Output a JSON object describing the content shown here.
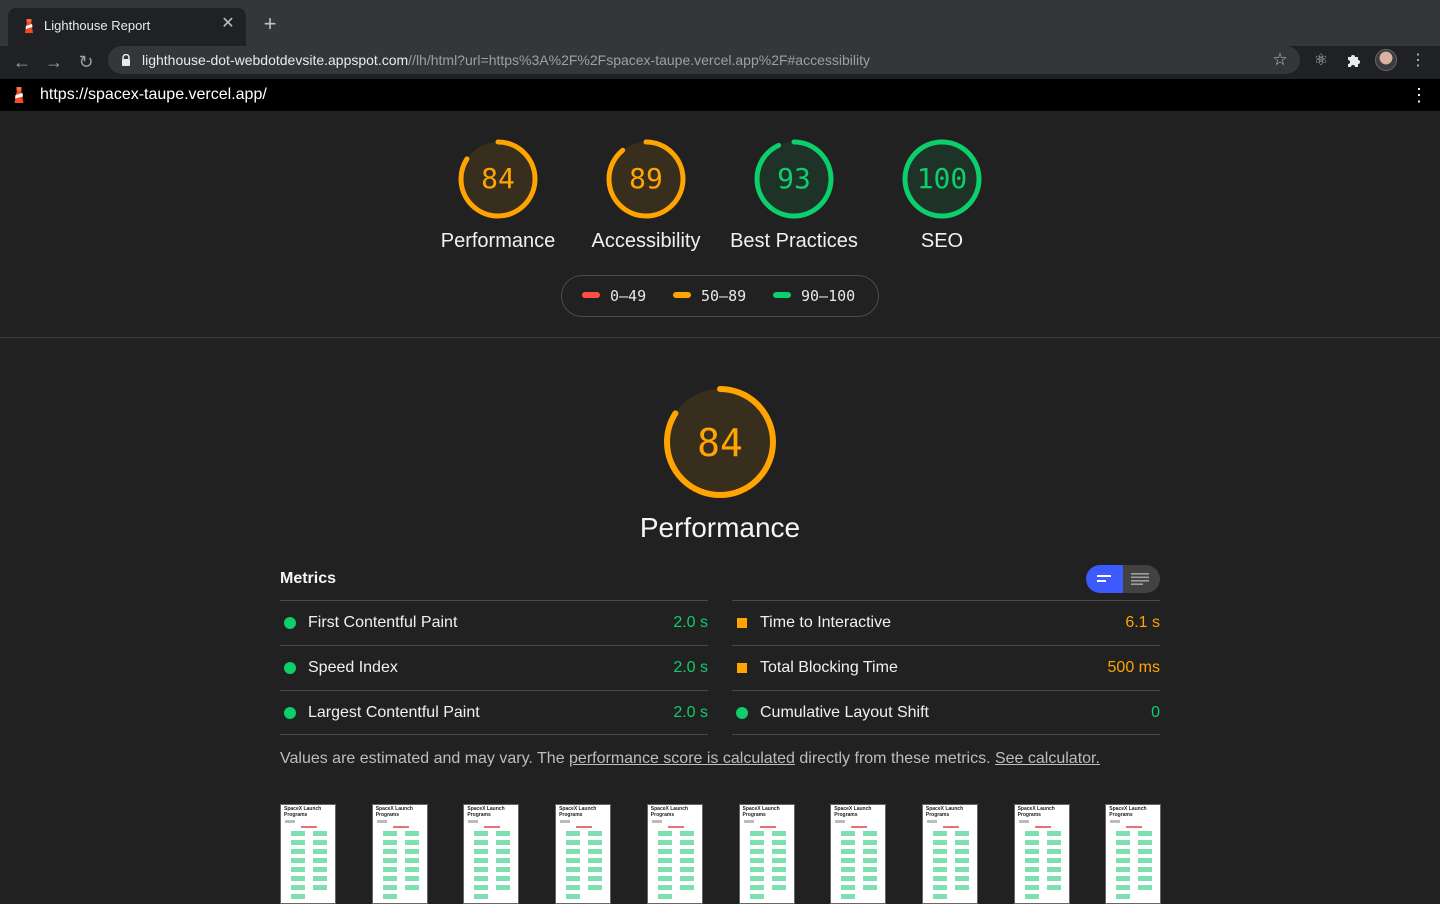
{
  "browser": {
    "tab_title": "Lighthouse Report",
    "url_host": "lighthouse-dot-webdotdevsite.appspot.com",
    "url_path": "//lh/html?url=https%3A%2F%2Fspacex-taupe.vercel.app%2F#accessibility"
  },
  "report": {
    "page_url": "https://spacex-taupe.vercel.app/"
  },
  "scores": [
    {
      "label": "Performance",
      "value": "84",
      "score": 84,
      "color": "#ffa400"
    },
    {
      "label": "Accessibility",
      "value": "89",
      "score": 89,
      "color": "#ffa400"
    },
    {
      "label": "Best Practices",
      "value": "93",
      "score": 93,
      "color": "#0cce6b"
    },
    {
      "label": "SEO",
      "value": "100",
      "score": 100,
      "color": "#0cce6b"
    }
  ],
  "legend": [
    {
      "range": "0–49",
      "color": "#ff4e42"
    },
    {
      "range": "50–89",
      "color": "#ffa400"
    },
    {
      "range": "90–100",
      "color": "#0cce6b"
    }
  ],
  "performance": {
    "value": "84",
    "score": 84,
    "label": "Performance",
    "color": "#ffa400"
  },
  "metrics": {
    "title": "Metrics",
    "left": [
      {
        "name": "First Contentful Paint",
        "value": "2.0 s",
        "status": "pass"
      },
      {
        "name": "Speed Index",
        "value": "2.0 s",
        "status": "pass"
      },
      {
        "name": "Largest Contentful Paint",
        "value": "2.0 s",
        "status": "pass"
      }
    ],
    "right": [
      {
        "name": "Time to Interactive",
        "value": "6.1 s",
        "status": "average"
      },
      {
        "name": "Total Blocking Time",
        "value": "500 ms",
        "status": "average"
      },
      {
        "name": "Cumulative Layout Shift",
        "value": "0",
        "status": "pass"
      }
    ]
  },
  "note": {
    "prefix": "Values are estimated and may vary. The ",
    "link1": "performance score is calculated",
    "middle": " directly from these metrics. ",
    "link2": "See calculator."
  },
  "filmstrip": {
    "thumb_title": "SpaceX Launch Programs"
  }
}
